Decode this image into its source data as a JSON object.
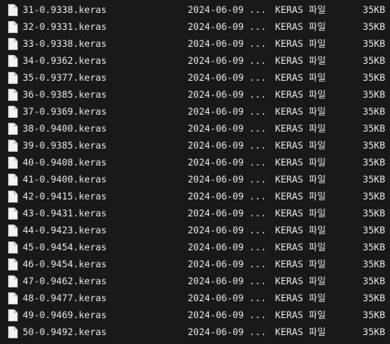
{
  "files": [
    {
      "name": "31-0.9338.keras",
      "date": "2024-06-09 ...",
      "type": "KERAS 파일",
      "size": "35KB",
      "icon": "file-icon"
    },
    {
      "name": "32-0.9331.keras",
      "date": "2024-06-09 ...",
      "type": "KERAS 파일",
      "size": "35KB",
      "icon": "file-icon"
    },
    {
      "name": "33-0.9338.keras",
      "date": "2024-06-09 ...",
      "type": "KERAS 파일",
      "size": "35KB",
      "icon": "file-icon"
    },
    {
      "name": "34-0.9362.keras",
      "date": "2024-06-09 ...",
      "type": "KERAS 파일",
      "size": "35KB",
      "icon": "file-icon"
    },
    {
      "name": "35-0.9377.keras",
      "date": "2024-06-09 ...",
      "type": "KERAS 파일",
      "size": "35KB",
      "icon": "file-icon"
    },
    {
      "name": "36-0.9385.keras",
      "date": "2024-06-09 ...",
      "type": "KERAS 파일",
      "size": "35KB",
      "icon": "file-icon"
    },
    {
      "name": "37-0.9369.keras",
      "date": "2024-06-09 ...",
      "type": "KERAS 파일",
      "size": "35KB",
      "icon": "file-icon"
    },
    {
      "name": "38-0.9400.keras",
      "date": "2024-06-09 ...",
      "type": "KERAS 파일",
      "size": "35KB",
      "icon": "file-icon"
    },
    {
      "name": "39-0.9385.keras",
      "date": "2024-06-09 ...",
      "type": "KERAS 파일",
      "size": "35KB",
      "icon": "file-icon"
    },
    {
      "name": "40-0.9408.keras",
      "date": "2024-06-09 ...",
      "type": "KERAS 파일",
      "size": "35KB",
      "icon": "file-icon"
    },
    {
      "name": "41-0.9400.keras",
      "date": "2024-06-09 ...",
      "type": "KERAS 파일",
      "size": "35KB",
      "icon": "file-icon"
    },
    {
      "name": "42-0.9415.keras",
      "date": "2024-06-09 ...",
      "type": "KERAS 파일",
      "size": "35KB",
      "icon": "file-icon"
    },
    {
      "name": "43-0.9431.keras",
      "date": "2024-06-09 ...",
      "type": "KERAS 파일",
      "size": "35KB",
      "icon": "file-icon"
    },
    {
      "name": "44-0.9423.keras",
      "date": "2024-06-09 ...",
      "type": "KERAS 파일",
      "size": "35KB",
      "icon": "file-icon"
    },
    {
      "name": "45-0.9454.keras",
      "date": "2024-06-09 ...",
      "type": "KERAS 파일",
      "size": "35KB",
      "icon": "file-icon"
    },
    {
      "name": "46-0.9454.keras",
      "date": "2024-06-09 ...",
      "type": "KERAS 파일",
      "size": "35KB",
      "icon": "file-icon"
    },
    {
      "name": "47-0.9462.keras",
      "date": "2024-06-09 ...",
      "type": "KERAS 파일",
      "size": "35KB",
      "icon": "file-icon"
    },
    {
      "name": "48-0.9477.keras",
      "date": "2024-06-09 ...",
      "type": "KERAS 파일",
      "size": "35KB",
      "icon": "file-icon"
    },
    {
      "name": "49-0.9469.keras",
      "date": "2024-06-09 ...",
      "type": "KERAS 파일",
      "size": "35KB",
      "icon": "file-icon"
    },
    {
      "name": "50-0.9492.keras",
      "date": "2024-06-09 ...",
      "type": "KERAS 파일",
      "size": "35KB",
      "icon": "file-icon"
    }
  ]
}
